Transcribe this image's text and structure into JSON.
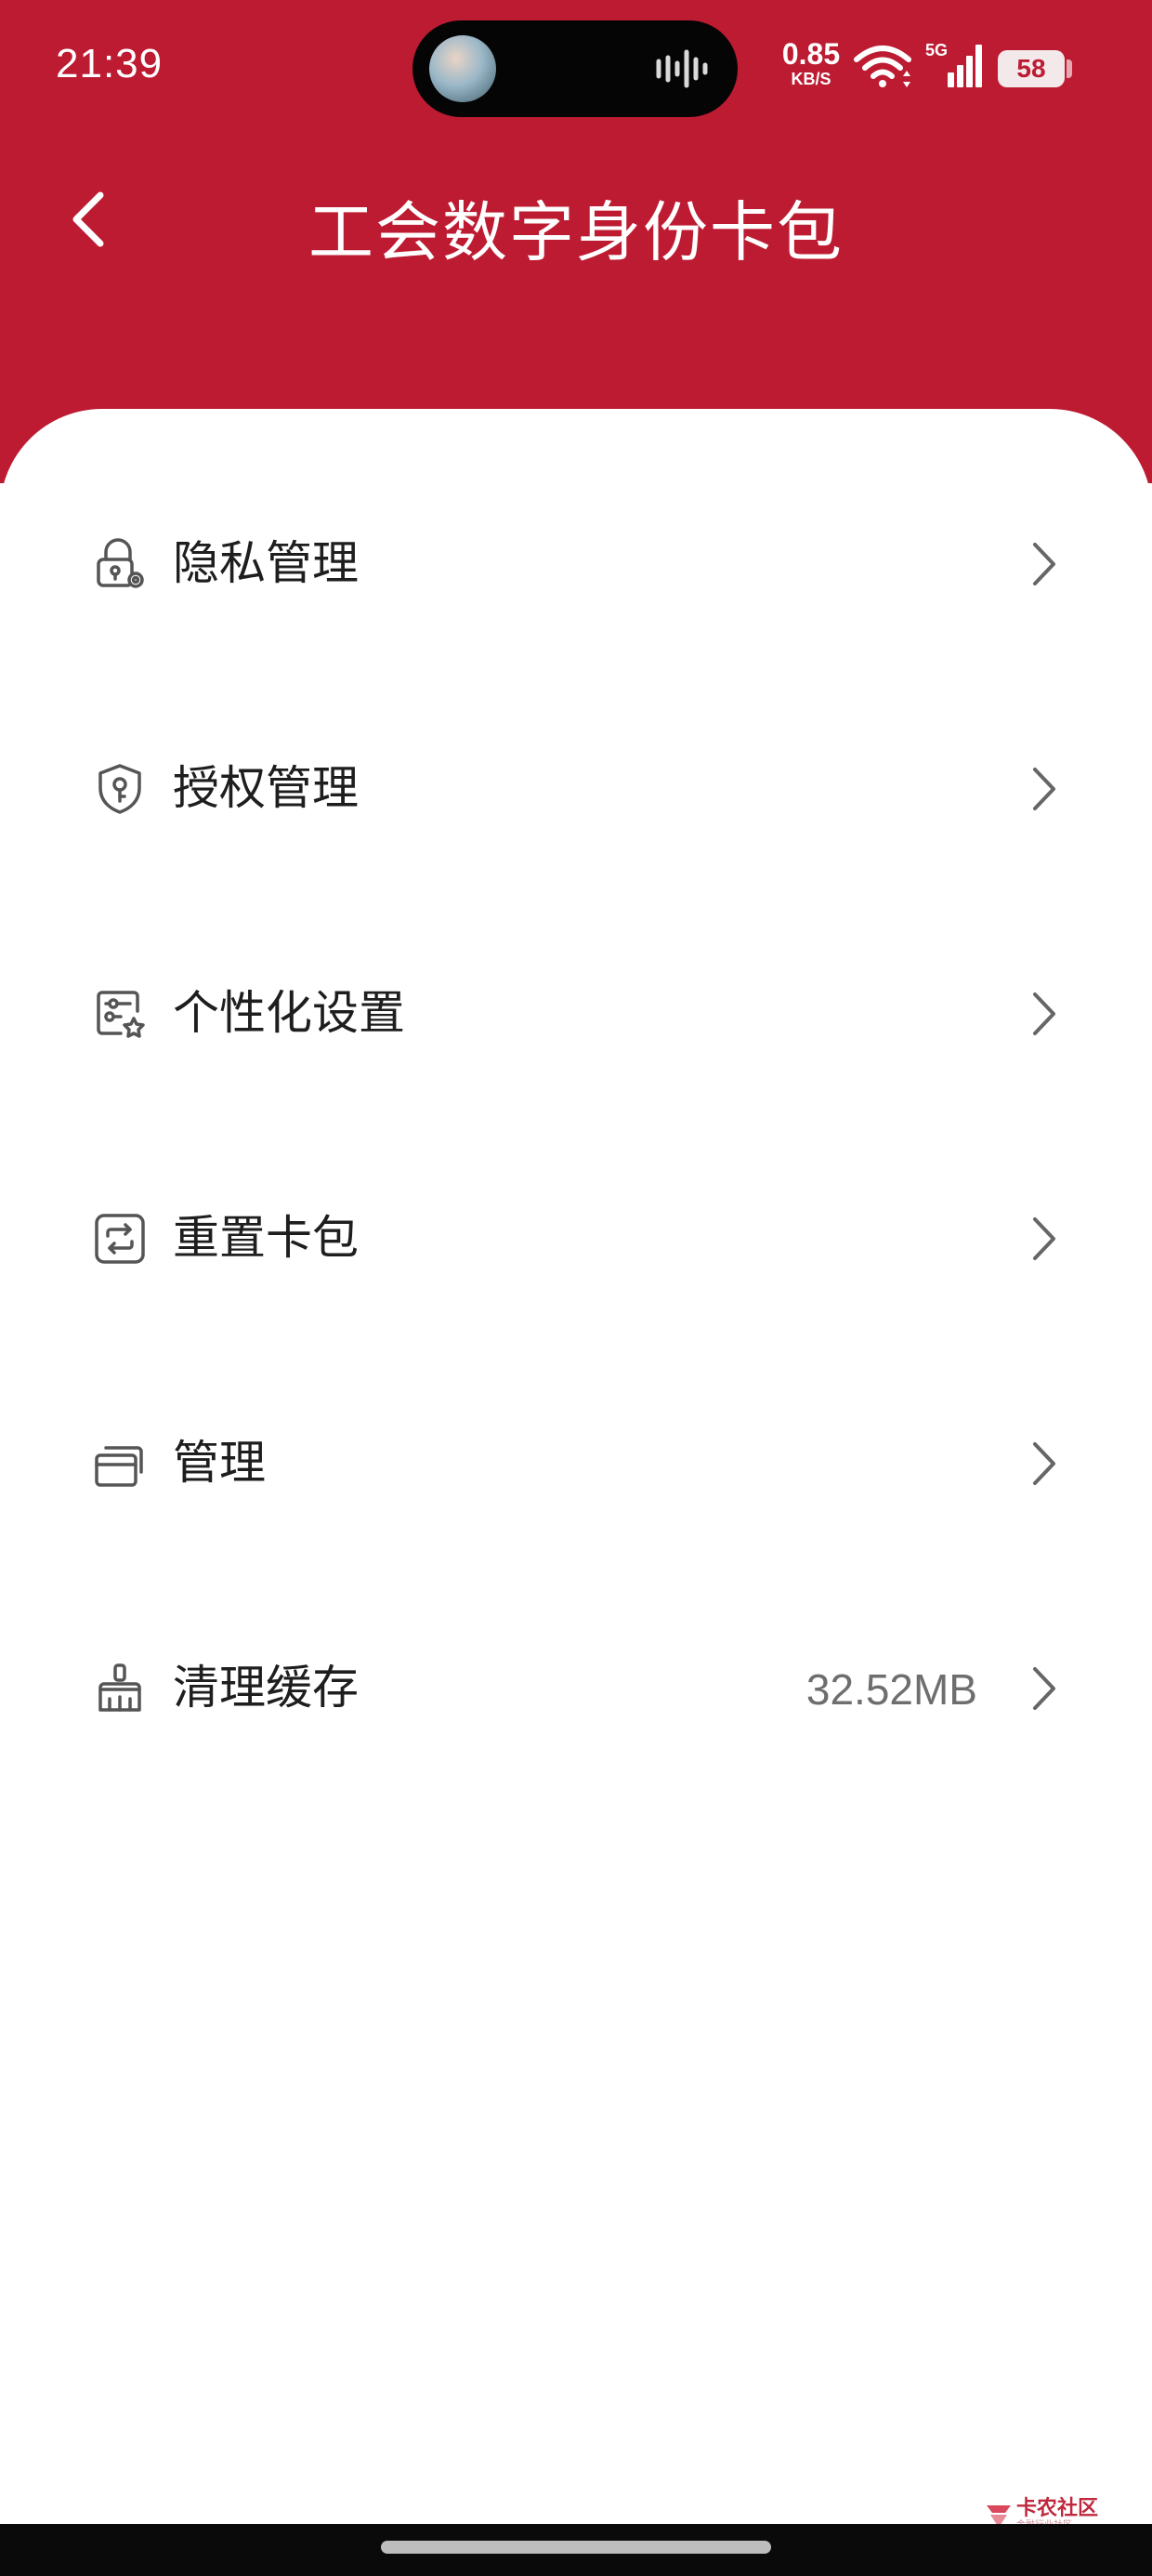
{
  "status_bar": {
    "time": "21:39",
    "net_speed_value": "0.85",
    "net_speed_unit": "KB/S",
    "signal_label": "5G",
    "battery": "58"
  },
  "header": {
    "title": "工会数字身份卡包",
    "back_icon": "chevron-left-icon",
    "background_color": "#BD1B32"
  },
  "menu": {
    "items": [
      {
        "label": "隐私管理",
        "icon": "lock-gear-icon",
        "value": ""
      },
      {
        "label": "授权管理",
        "icon": "shield-key-icon",
        "value": ""
      },
      {
        "label": "个性化设置",
        "icon": "settings-star-icon",
        "value": ""
      },
      {
        "label": "重置卡包",
        "icon": "reset-icon",
        "value": ""
      },
      {
        "label": "管理",
        "icon": "cards-icon",
        "value": ""
      },
      {
        "label": "清理缓存",
        "icon": "broom-icon",
        "value": "32.52MB"
      }
    ]
  },
  "watermark": {
    "text": "卡农社区",
    "subtext": "金融行业社区"
  }
}
